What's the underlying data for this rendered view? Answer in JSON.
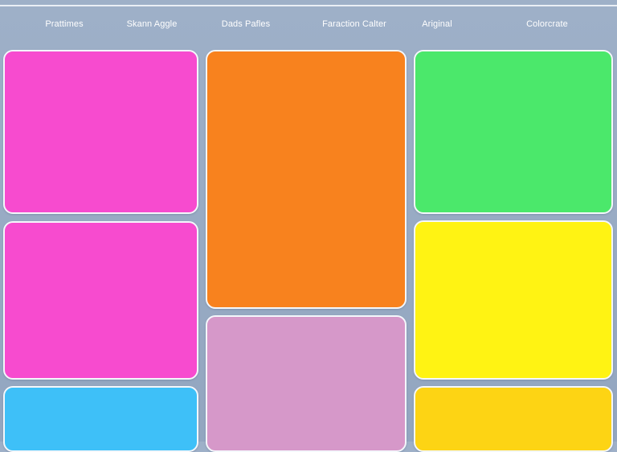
{
  "nav": {
    "items": [
      {
        "label": "Prattimes"
      },
      {
        "label": "Skann Aggle"
      },
      {
        "label": "Dads Pafles"
      },
      {
        "label": "Faraction Calter"
      },
      {
        "label": "Ariginal"
      },
      {
        "label": "Colorcrate"
      }
    ]
  },
  "palette": {
    "background": "#97a9c2",
    "tiles": [
      {
        "name": "magenta-top",
        "color": "#f74bcf"
      },
      {
        "name": "orange",
        "color": "#f8821e"
      },
      {
        "name": "green",
        "color": "#4be86b"
      },
      {
        "name": "magenta-middle",
        "color": "#f74bcf"
      },
      {
        "name": "yellow",
        "color": "#fff313"
      },
      {
        "name": "lilac",
        "color": "#d698c9"
      },
      {
        "name": "sky-blue",
        "color": "#3ec0f8"
      },
      {
        "name": "golden-yellow",
        "color": "#fdd414"
      }
    ]
  }
}
